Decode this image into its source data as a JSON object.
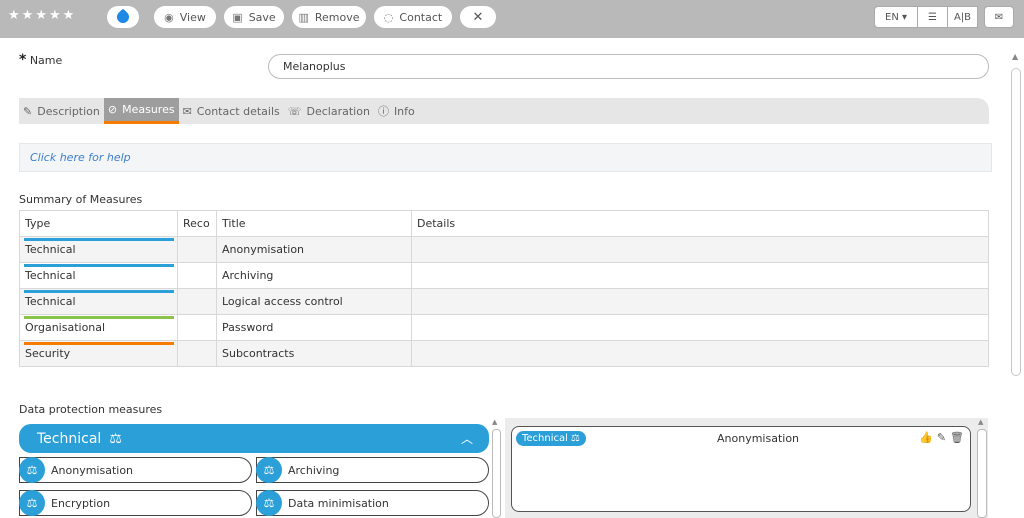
{
  "toolbar": {
    "stars": [
      "★",
      "★",
      "★",
      "★",
      "★"
    ],
    "view_label": "View",
    "save_label": "Save",
    "remove_label": "Remove",
    "contact_label": "Contact",
    "close_label": "✕",
    "lang_label": "EN ▾",
    "list_label": "☰",
    "ab_label": "A|B",
    "mail_label": "✉"
  },
  "form": {
    "name_required": "*",
    "name_label": "Name",
    "name_value": "Melanoplus"
  },
  "tabs": [
    {
      "icon": "✎",
      "label": "Description"
    },
    {
      "icon": "⊘",
      "label": "Measures"
    },
    {
      "icon": "✉",
      "label": "Contact details"
    },
    {
      "icon": "☏",
      "label": "Declaration"
    },
    {
      "icon": "ⓘ",
      "label": "Info"
    }
  ],
  "help_text": "Click here for help",
  "summary": {
    "title": "Summary of Measures",
    "headers": [
      "Type",
      "Reco",
      "Title",
      "Details"
    ],
    "rows": [
      {
        "type": "Technical",
        "reco": "",
        "title": "Anonymisation",
        "details": "",
        "color": "#2b9fd8"
      },
      {
        "type": "Technical",
        "reco": "",
        "title": "Archiving",
        "details": "",
        "color": "#2b9fd8"
      },
      {
        "type": "Technical",
        "reco": "",
        "title": "Logical access control",
        "details": "",
        "color": "#2b9fd8"
      },
      {
        "type": "Organisational",
        "reco": "",
        "title": "Password",
        "details": "",
        "color": "#8bc34a"
      },
      {
        "type": "Security",
        "reco": "",
        "title": "Subcontracts",
        "details": "",
        "color": "#f57c00"
      }
    ]
  },
  "data_protection": {
    "title": "Data protection measures",
    "group_label": "Technical",
    "group_icon": "⚖",
    "chevron": "︿",
    "items": [
      "Anonymisation",
      "Archiving",
      "Encryption",
      "Data minimisation"
    ]
  },
  "detail_card": {
    "chip_label": "Technical",
    "chip_icon": "⚖",
    "title": "Anonymisation",
    "actions": [
      "👍",
      "✎",
      "🗑"
    ]
  },
  "colors": {
    "accent": "#2b9fd8",
    "active_tab_underline": "#f57c00",
    "toolbar_bg": "#b9b9b9"
  }
}
